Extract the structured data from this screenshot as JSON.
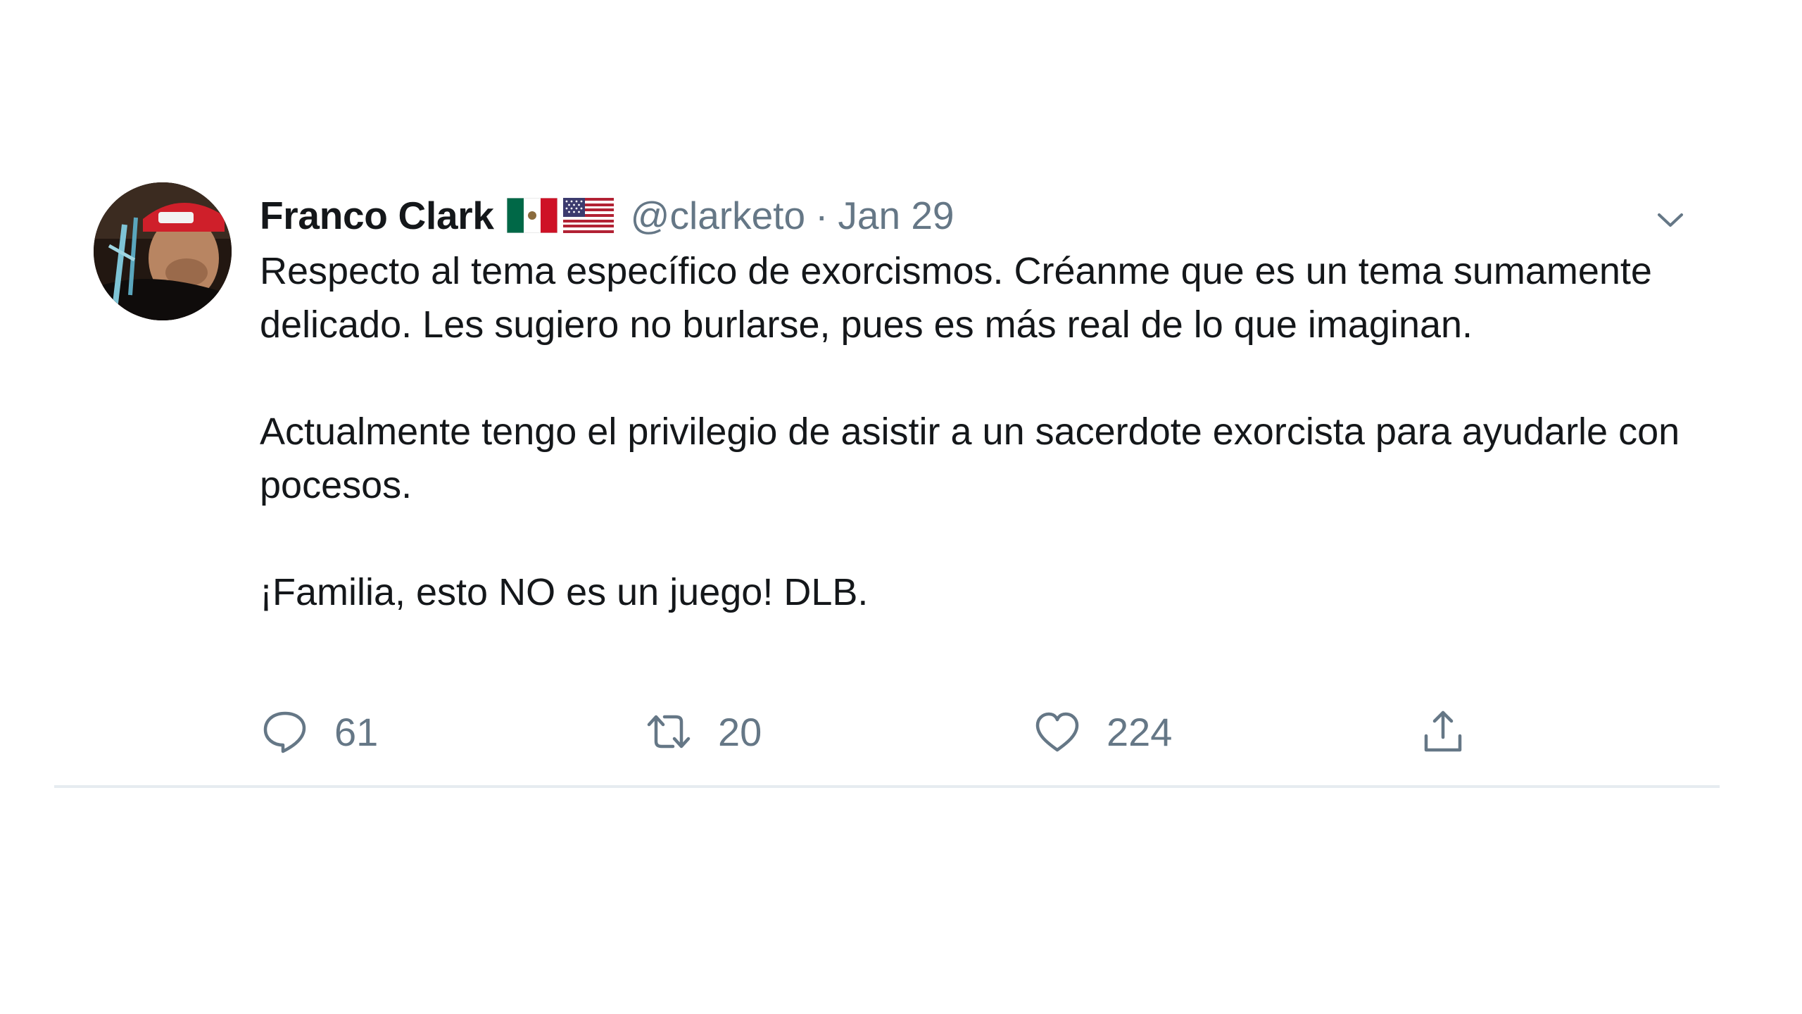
{
  "tweet": {
    "author": {
      "name": "Franco Clark",
      "flag_icons": [
        "mexico-flag-icon",
        "usa-flag-icon"
      ],
      "handle": "@clarketo"
    },
    "separator": "·",
    "date": "Jan 29",
    "paragraphs": [
      "Respecto al tema específico de exorcismos. Créanme que es un tema sumamente delicado. Les sugiero no burlarse, pues es más real de lo que imaginan.",
      "Actualmente tengo el privilegio de asistir a un sacerdote exorcista para ayudarle con pocesos.",
      "¡Familia, esto NO es un juego! DLB."
    ],
    "actions": {
      "reply": {
        "icon": "speech-bubble-icon",
        "count": "61"
      },
      "retweet": {
        "icon": "retweet-icon",
        "count": "20"
      },
      "like": {
        "icon": "heart-icon",
        "count": "224"
      },
      "share": {
        "icon": "share-icon"
      }
    },
    "menu_icon": "chevron-down-icon"
  },
  "colors": {
    "text": "#14171a",
    "secondary": "#657786",
    "divider": "#e6ecf0"
  }
}
